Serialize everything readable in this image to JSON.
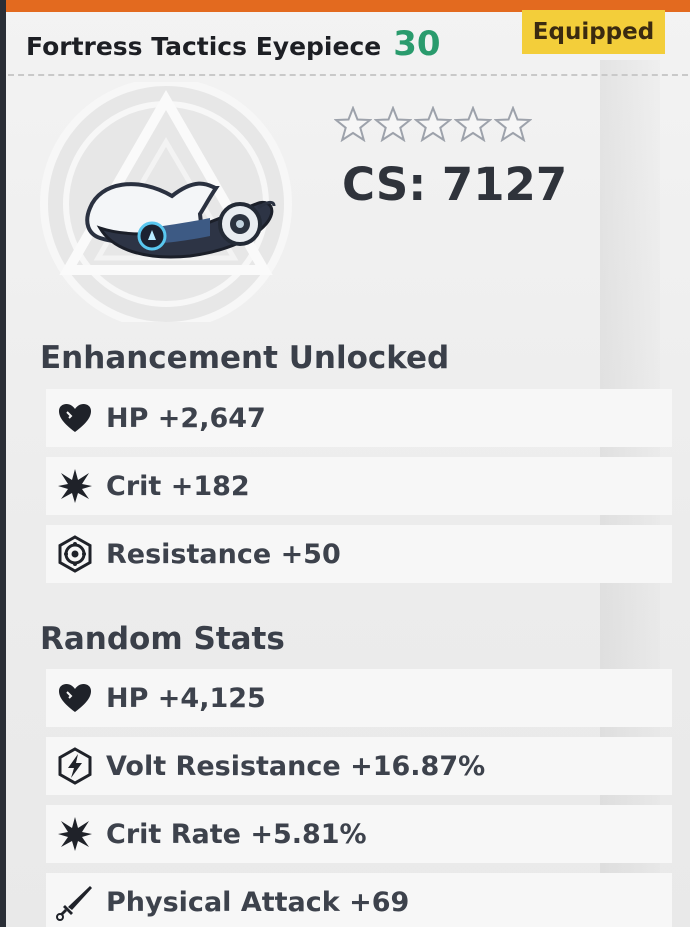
{
  "item": {
    "name": "Fortress Tactics Eyepiece",
    "level": "30",
    "equipped_label": "Equipped",
    "combat_score": "CS: 7127",
    "stars_total": 5,
    "stars_filled": 0,
    "icon": "eyepiece-visor-icon"
  },
  "enhancement": {
    "title": "Enhancement Unlocked",
    "stats": [
      {
        "icon": "heart-icon",
        "text": "HP +2,647"
      },
      {
        "icon": "burst-icon",
        "text": "Crit +182"
      },
      {
        "icon": "resistance-icon",
        "text": "Resistance +50"
      }
    ]
  },
  "random": {
    "title": "Random Stats",
    "stats": [
      {
        "icon": "heart-icon",
        "text": "HP +4,125"
      },
      {
        "icon": "volt-icon",
        "text": "Volt Resistance +16.87%"
      },
      {
        "icon": "burst-icon",
        "text": "Crit Rate +5.81%"
      },
      {
        "icon": "sword-icon",
        "text": "Physical Attack +69"
      }
    ]
  },
  "colors": {
    "accent_orange": "#e36a1f",
    "level_green": "#2a9b6d",
    "badge_yellow": "#f3ce3a"
  }
}
